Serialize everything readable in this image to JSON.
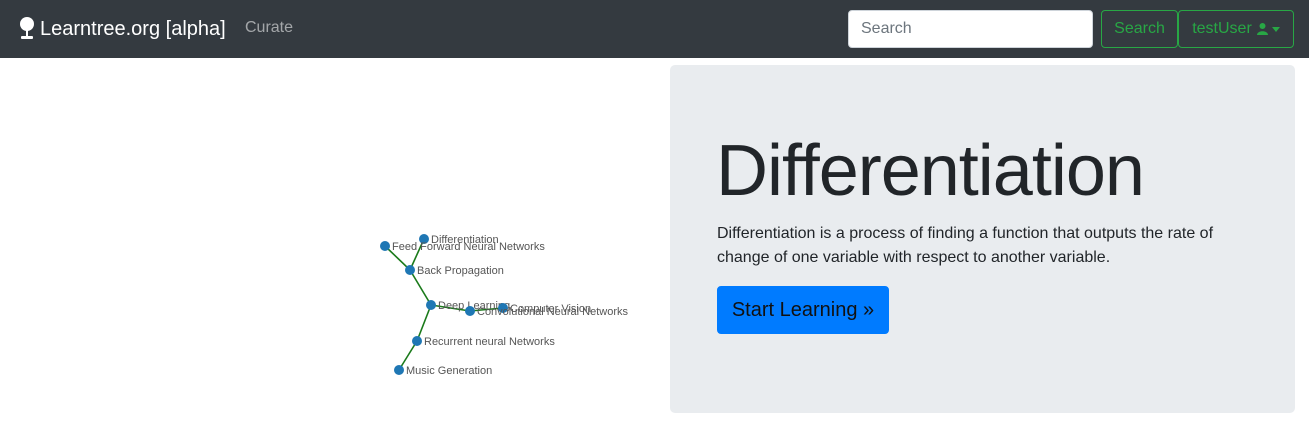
{
  "navbar": {
    "brand": "Learntree.org [alpha]",
    "brand_icon": "lightbulb-icon",
    "curate_label": "Curate",
    "search_placeholder": "Search",
    "search_button": "Search",
    "user_label": "testUser",
    "user_icon": "user-icon",
    "accent_color": "#28a745",
    "bg_color": "#343a40"
  },
  "graph": {
    "nodes": [
      {
        "id": "differentiation",
        "label": "Differentiation"
      },
      {
        "id": "feed-forward",
        "label": "Feed Forward Neural Networks"
      },
      {
        "id": "back-propagation",
        "label": "Back Propagation"
      },
      {
        "id": "deep-learning",
        "label": "Deep Learning"
      },
      {
        "id": "computer-vision",
        "label": "Computer Vision"
      },
      {
        "id": "convolutional",
        "label": "Convolutional Neural Networks"
      },
      {
        "id": "recurrent",
        "label": "Recurrent neural Networks"
      },
      {
        "id": "music-generation",
        "label": "Music Generation"
      }
    ],
    "node_color": "#1f77b4",
    "edge_color": "#1a7a1a"
  },
  "jumbotron": {
    "title": "Differentiation",
    "description": "Differentiation is a process of finding a function that outputs the rate of change of one variable with respect to another variable.",
    "button_label": "Start Learning »",
    "button_color": "#007bff"
  }
}
